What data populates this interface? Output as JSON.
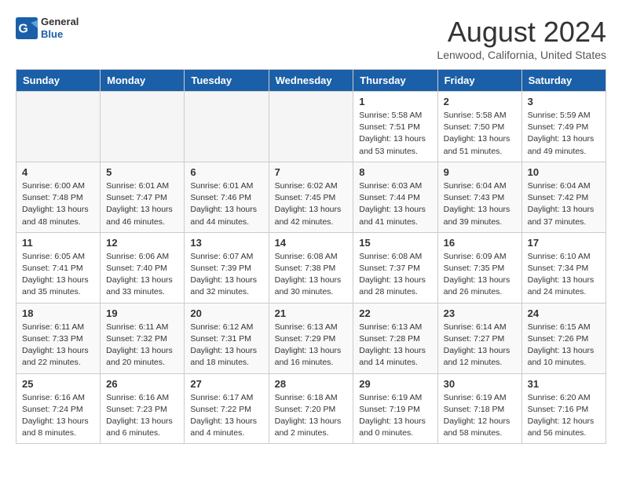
{
  "header": {
    "logo_line1": "General",
    "logo_line2": "Blue",
    "month": "August 2024",
    "location": "Lenwood, California, United States"
  },
  "days_of_week": [
    "Sunday",
    "Monday",
    "Tuesday",
    "Wednesday",
    "Thursday",
    "Friday",
    "Saturday"
  ],
  "weeks": [
    [
      {
        "num": "",
        "info": ""
      },
      {
        "num": "",
        "info": ""
      },
      {
        "num": "",
        "info": ""
      },
      {
        "num": "",
        "info": ""
      },
      {
        "num": "1",
        "info": "Sunrise: 5:58 AM\nSunset: 7:51 PM\nDaylight: 13 hours\nand 53 minutes."
      },
      {
        "num": "2",
        "info": "Sunrise: 5:58 AM\nSunset: 7:50 PM\nDaylight: 13 hours\nand 51 minutes."
      },
      {
        "num": "3",
        "info": "Sunrise: 5:59 AM\nSunset: 7:49 PM\nDaylight: 13 hours\nand 49 minutes."
      }
    ],
    [
      {
        "num": "4",
        "info": "Sunrise: 6:00 AM\nSunset: 7:48 PM\nDaylight: 13 hours\nand 48 minutes."
      },
      {
        "num": "5",
        "info": "Sunrise: 6:01 AM\nSunset: 7:47 PM\nDaylight: 13 hours\nand 46 minutes."
      },
      {
        "num": "6",
        "info": "Sunrise: 6:01 AM\nSunset: 7:46 PM\nDaylight: 13 hours\nand 44 minutes."
      },
      {
        "num": "7",
        "info": "Sunrise: 6:02 AM\nSunset: 7:45 PM\nDaylight: 13 hours\nand 42 minutes."
      },
      {
        "num": "8",
        "info": "Sunrise: 6:03 AM\nSunset: 7:44 PM\nDaylight: 13 hours\nand 41 minutes."
      },
      {
        "num": "9",
        "info": "Sunrise: 6:04 AM\nSunset: 7:43 PM\nDaylight: 13 hours\nand 39 minutes."
      },
      {
        "num": "10",
        "info": "Sunrise: 6:04 AM\nSunset: 7:42 PM\nDaylight: 13 hours\nand 37 minutes."
      }
    ],
    [
      {
        "num": "11",
        "info": "Sunrise: 6:05 AM\nSunset: 7:41 PM\nDaylight: 13 hours\nand 35 minutes."
      },
      {
        "num": "12",
        "info": "Sunrise: 6:06 AM\nSunset: 7:40 PM\nDaylight: 13 hours\nand 33 minutes."
      },
      {
        "num": "13",
        "info": "Sunrise: 6:07 AM\nSunset: 7:39 PM\nDaylight: 13 hours\nand 32 minutes."
      },
      {
        "num": "14",
        "info": "Sunrise: 6:08 AM\nSunset: 7:38 PM\nDaylight: 13 hours\nand 30 minutes."
      },
      {
        "num": "15",
        "info": "Sunrise: 6:08 AM\nSunset: 7:37 PM\nDaylight: 13 hours\nand 28 minutes."
      },
      {
        "num": "16",
        "info": "Sunrise: 6:09 AM\nSunset: 7:35 PM\nDaylight: 13 hours\nand 26 minutes."
      },
      {
        "num": "17",
        "info": "Sunrise: 6:10 AM\nSunset: 7:34 PM\nDaylight: 13 hours\nand 24 minutes."
      }
    ],
    [
      {
        "num": "18",
        "info": "Sunrise: 6:11 AM\nSunset: 7:33 PM\nDaylight: 13 hours\nand 22 minutes."
      },
      {
        "num": "19",
        "info": "Sunrise: 6:11 AM\nSunset: 7:32 PM\nDaylight: 13 hours\nand 20 minutes."
      },
      {
        "num": "20",
        "info": "Sunrise: 6:12 AM\nSunset: 7:31 PM\nDaylight: 13 hours\nand 18 minutes."
      },
      {
        "num": "21",
        "info": "Sunrise: 6:13 AM\nSunset: 7:29 PM\nDaylight: 13 hours\nand 16 minutes."
      },
      {
        "num": "22",
        "info": "Sunrise: 6:13 AM\nSunset: 7:28 PM\nDaylight: 13 hours\nand 14 minutes."
      },
      {
        "num": "23",
        "info": "Sunrise: 6:14 AM\nSunset: 7:27 PM\nDaylight: 13 hours\nand 12 minutes."
      },
      {
        "num": "24",
        "info": "Sunrise: 6:15 AM\nSunset: 7:26 PM\nDaylight: 13 hours\nand 10 minutes."
      }
    ],
    [
      {
        "num": "25",
        "info": "Sunrise: 6:16 AM\nSunset: 7:24 PM\nDaylight: 13 hours\nand 8 minutes."
      },
      {
        "num": "26",
        "info": "Sunrise: 6:16 AM\nSunset: 7:23 PM\nDaylight: 13 hours\nand 6 minutes."
      },
      {
        "num": "27",
        "info": "Sunrise: 6:17 AM\nSunset: 7:22 PM\nDaylight: 13 hours\nand 4 minutes."
      },
      {
        "num": "28",
        "info": "Sunrise: 6:18 AM\nSunset: 7:20 PM\nDaylight: 13 hours\nand 2 minutes."
      },
      {
        "num": "29",
        "info": "Sunrise: 6:19 AM\nSunset: 7:19 PM\nDaylight: 13 hours\nand 0 minutes."
      },
      {
        "num": "30",
        "info": "Sunrise: 6:19 AM\nSunset: 7:18 PM\nDaylight: 12 hours\nand 58 minutes."
      },
      {
        "num": "31",
        "info": "Sunrise: 6:20 AM\nSunset: 7:16 PM\nDaylight: 12 hours\nand 56 minutes."
      }
    ]
  ]
}
